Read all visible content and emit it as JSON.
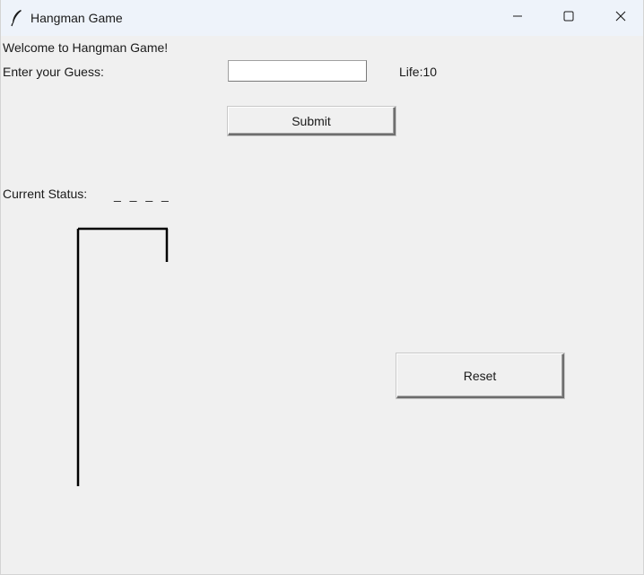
{
  "window": {
    "title": "Hangman Game",
    "app_icon": "feather-icon",
    "controls": {
      "minimize_icon": "minimize-icon",
      "maximize_icon": "maximize-icon",
      "close_icon": "close-icon"
    }
  },
  "game": {
    "welcome_text": "Welcome to Hangman Game!",
    "guess_label": "Enter your Guess:",
    "guess_value": "",
    "life_text": "Life:10",
    "submit_label": "Submit",
    "status_label": "Current Status:",
    "status_word": "_ _ _ _",
    "reset_label": "Reset"
  },
  "colors": {
    "window_bg": "#f0f0f0",
    "titlebar_bg": "#eef3fa",
    "drawing": "#000000"
  }
}
